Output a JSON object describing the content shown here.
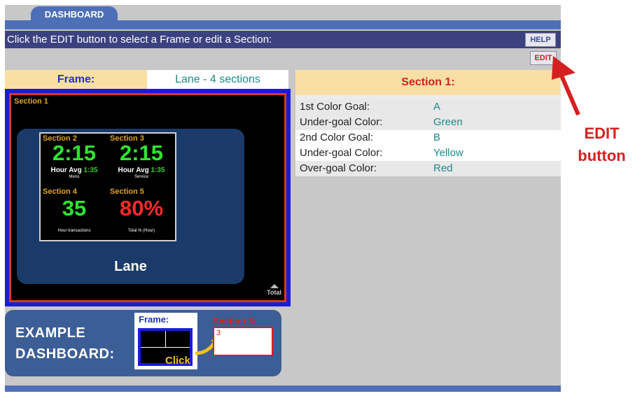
{
  "tab": {
    "label": "DASHBOARD"
  },
  "instruction": "Click the EDIT button to select a Frame or edit a Section:",
  "buttons": {
    "help": "HELP",
    "edit": "EDIT"
  },
  "frame": {
    "label": "Frame:",
    "value": "Lane - 4 sections"
  },
  "section_panel": {
    "title": "Section 1:",
    "rows": [
      {
        "key": "1st Color Goal:",
        "value": "A"
      },
      {
        "key": "Under-goal Color:",
        "value": "Green"
      },
      {
        "key": "2nd Color Goal:",
        "value": "B"
      },
      {
        "key": "Under-goal Color:",
        "value": "Yellow"
      },
      {
        "key": "Over-goal Color:",
        "value": "Red"
      }
    ]
  },
  "preview": {
    "section1_label": "Section 1",
    "lane_label": "Lane",
    "total_label": "Total",
    "cells": [
      {
        "label": "Section 2",
        "value": "2:15",
        "sub": "Hour Avg",
        "sub_value": "1:35",
        "tiny": "Menu"
      },
      {
        "label": "Section 3",
        "value": "2:15",
        "sub": "Hour Avg",
        "sub_value": "1:35",
        "tiny": "Service"
      },
      {
        "label": "Section 4",
        "value": "35",
        "tiny": "Hour transactions"
      },
      {
        "label": "Section 5",
        "value": "80%",
        "tiny": "Total % (Hour)"
      }
    ]
  },
  "example": {
    "text": "EXAMPLE\nDASHBOARD:",
    "frame_label": "Frame:",
    "click_label": "Click",
    "section_label": "Section 3:",
    "section_value": "3"
  },
  "callout": {
    "line1": "EDIT",
    "line2": "button"
  },
  "colors": {
    "accent_blue": "#4d6fb8",
    "header_bar": "#3c4280",
    "panel_bg": "#c8c8c8",
    "highlight_tan": "#f9dfa4",
    "alert_red": "#d42020",
    "teal_value": "#1c8a8a",
    "green_value": "#2ee52e",
    "red_value": "#ff2a2a",
    "gold_label": "#e0a420"
  },
  "icons": {
    "callout_arrow": "red-arrow-icon",
    "click_arrow": "curved-arrow-icon",
    "total": "triangle-up-icon"
  }
}
